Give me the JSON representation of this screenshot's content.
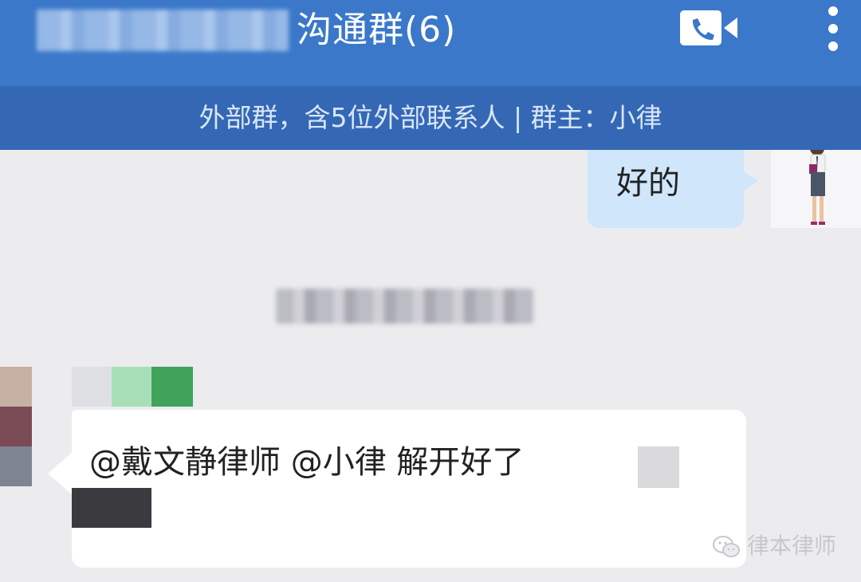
{
  "header": {
    "title": "沟通群(6)",
    "video_call_icon": "video-call-icon",
    "more_icon": "more-vertical-icon"
  },
  "subheader": {
    "text": "外部群，含5位外部联系人 | 群主：小律"
  },
  "messages": [
    {
      "side": "right",
      "text": "好的"
    },
    {
      "side": "left",
      "text": "@戴文静律师 @小律 解开好了"
    }
  ],
  "watermark": {
    "text": "律本律师",
    "icon": "wechat-icon"
  },
  "colors": {
    "header_bg": "#3b78c9",
    "subheader_bg": "#3468b5",
    "chat_bg": "#ececef",
    "own_bubble": "#cfe6fb",
    "other_bubble": "#ffffff"
  }
}
